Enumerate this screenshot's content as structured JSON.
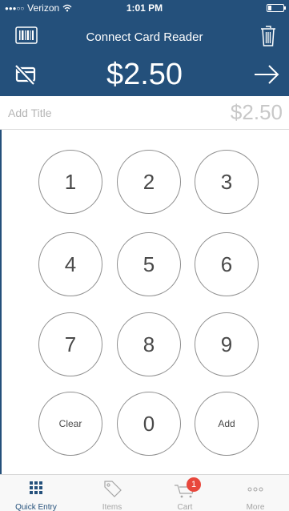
{
  "status_bar": {
    "carrier": "Verizon",
    "time": "1:01 PM"
  },
  "header": {
    "title": "Connect Card Reader",
    "amount": "$2.50"
  },
  "entry": {
    "title_placeholder": "Add Title",
    "line_amount": "$2.50"
  },
  "keypad": {
    "keys": [
      "1",
      "2",
      "3",
      "4",
      "5",
      "6",
      "7",
      "8",
      "9",
      "Clear",
      "0",
      "Add"
    ]
  },
  "tabbar": {
    "tabs": [
      {
        "label": "Quick Entry",
        "icon": "grid-icon",
        "active": true
      },
      {
        "label": "Items",
        "icon": "tag-icon"
      },
      {
        "label": "Cart",
        "icon": "cart-icon",
        "badge": "1"
      },
      {
        "label": "More",
        "icon": "more-icon"
      }
    ]
  },
  "colors": {
    "header_bg": "#24507b",
    "badge": "#e8473c",
    "active_tab": "#24507b"
  }
}
